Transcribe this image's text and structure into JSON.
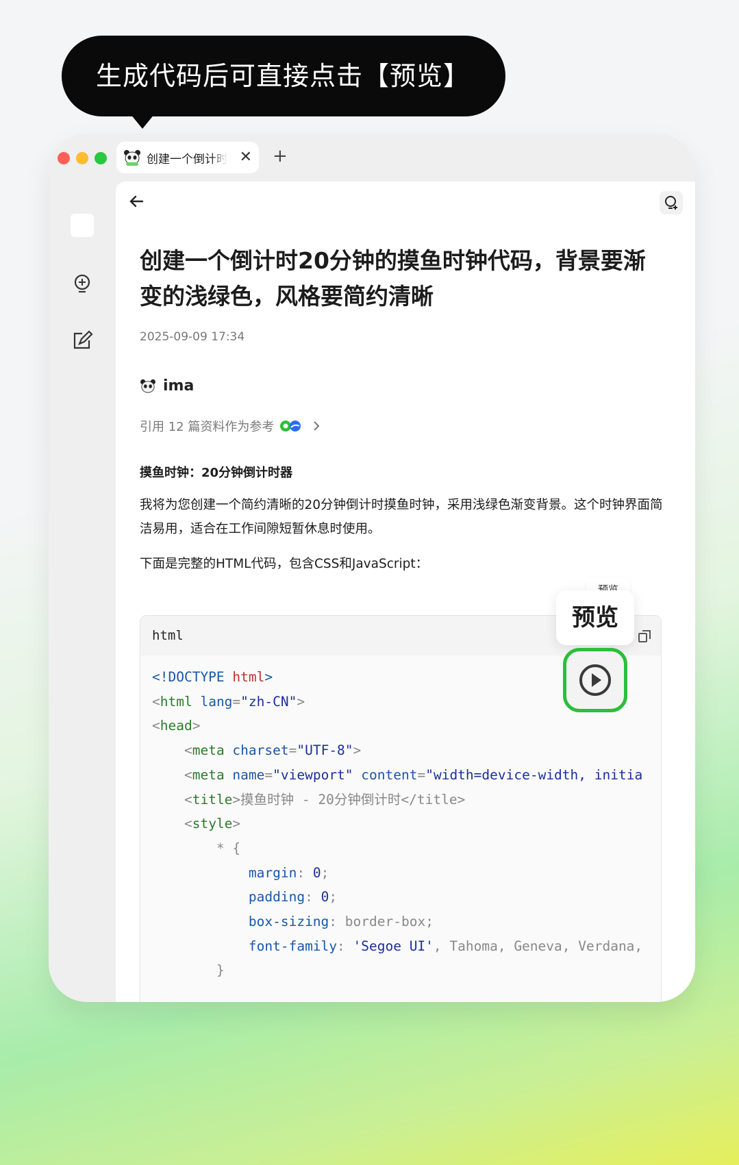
{
  "callout": {
    "text": "生成代码后可直接点击【预览】"
  },
  "tab": {
    "title": "创建一个倒计时",
    "close": "✕",
    "new_tab": "+"
  },
  "conversation": {
    "title": "创建一个倒计时20分钟的摸鱼时钟代码，背景要渐变的浅绿色，风格要简约清晰",
    "timestamp": "2025-09-09 17:34",
    "author": "ima",
    "refs_text": "引用 12 篇资料作为参考",
    "heading": "摸鱼时钟：20分钟倒计时器",
    "paragraph1": "我将为您创建一个简约清晰的20分钟倒计时摸鱼时钟，采用浅绿色渐变背景。这个时钟界面简洁易用，适合在工作间隙短暂休息时使用。",
    "paragraph2": "下面是完整的HTML代码，包含CSS和JavaScript："
  },
  "code": {
    "lang": "html",
    "lines": {
      "l1": {
        "a": "<!DOCTYPE ",
        "b": "html",
        "c": ">"
      },
      "l2": {
        "a": "<",
        "b": "html",
        "c": " lang",
        "d": "=",
        "e": "\"zh-CN\"",
        "f": ">"
      },
      "l3": {
        "a": "<",
        "b": "head",
        "c": ">"
      },
      "l4": {
        "a": "<",
        "b": "meta",
        "c": " charset",
        "d": "=",
        "e": "\"UTF-8\"",
        "f": ">"
      },
      "l5": {
        "a": "<",
        "b": "meta",
        "c": " name",
        "d": "=",
        "e": "\"viewport\"",
        "f": " content",
        "g": "=",
        "h": "\"width=device-width, initia"
      },
      "l6": {
        "a": "<",
        "b": "title",
        "c": ">",
        "d": "摸鱼时钟 - 20分钟倒计时",
        "e": "</title>"
      },
      "l7": {
        "a": "<",
        "b": "style",
        "c": ">"
      },
      "l8": {
        "a": "* {"
      },
      "l9": {
        "a": "margin",
        "b": ": ",
        "c": "0",
        "d": ";"
      },
      "l10": {
        "a": "padding",
        "b": ": ",
        "c": "0",
        "d": ";"
      },
      "l11": {
        "a": "box-sizing",
        "b": ": ",
        "c": "border-box",
        "d": ";"
      },
      "l12": {
        "a": "font-family",
        "b": ": ",
        "c": "'Segoe UI'",
        "d": ", Tahoma, Geneva, Verdana,"
      },
      "l13": {
        "a": "}"
      }
    }
  },
  "preview": {
    "tooltip": "预览",
    "ghost_label": "预览"
  },
  "colors": {
    "accent_green": "#2bbf3a",
    "callout_bg": "#0a0a0a"
  }
}
